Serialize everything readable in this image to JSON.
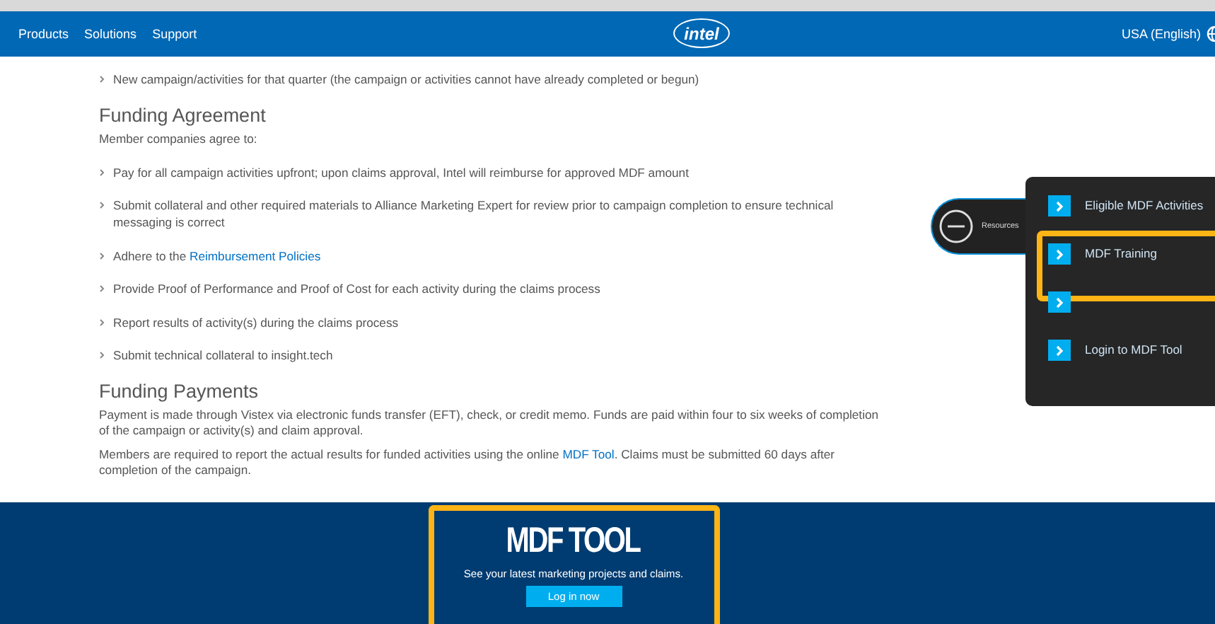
{
  "header": {
    "nav": [
      "Products",
      "Solutions",
      "Support"
    ],
    "logo": "intel",
    "locale": "USA (English)"
  },
  "intro_bullets": [
    [
      {
        "text": "New campaign/activities for that quarter (the campaign or activities cannot have already completed or begun)"
      }
    ]
  ],
  "sections": [
    {
      "heading": "Funding Agreement",
      "intro": "Member companies agree to:",
      "bullets": [
        [
          {
            "text": "Pay for all campaign activities upfront; upon claims approval, Intel will reimburse for approved MDF amount"
          }
        ],
        [
          {
            "text": "Submit collateral and other required materials to Alliance Marketing Expert for review prior to campaign completion to ensure technical messaging is correct"
          }
        ],
        [
          {
            "text": "Adhere to the "
          },
          {
            "text": "Reimbursement Policies",
            "kind": "link"
          }
        ],
        [
          {
            "text": "Provide Proof of Performance and Proof of Cost for each activity during the claims process"
          }
        ],
        [
          {
            "text": "Report results of activity(s) during the claims process"
          }
        ],
        [
          {
            "text": "Submit technical collateral to insight.tech"
          }
        ]
      ]
    },
    {
      "heading": "Funding Payments",
      "paragraphs": [
        [
          {
            "text": "Payment is made through Vistex via electronic funds transfer (EFT), check, or credit memo. Funds are paid within four to six weeks of completion of the campaign or activity(s) and claim approval."
          }
        ],
        [
          {
            "text": "Members are required to report the actual results for funded activities using the online "
          },
          {
            "text": "MDF Tool",
            "kind": "link"
          },
          {
            "text": ". Claims must be submitted 60 days after completion of the campaign."
          }
        ]
      ]
    }
  ],
  "resources": {
    "label": "Resources",
    "expanded": true,
    "items": [
      {
        "label": "Eligible MDF Activities",
        "highlighted": false
      },
      {
        "label": "MDF Training",
        "highlighted": true
      },
      {
        "highlighted": false
      },
      {
        "label": "Login to MDF Tool",
        "highlighted": false
      }
    ]
  },
  "banner": {
    "title": "MDF TOOL",
    "subtitle": "See your latest marketing projects and claims.",
    "button": "Log in now",
    "highlighted": true
  }
}
